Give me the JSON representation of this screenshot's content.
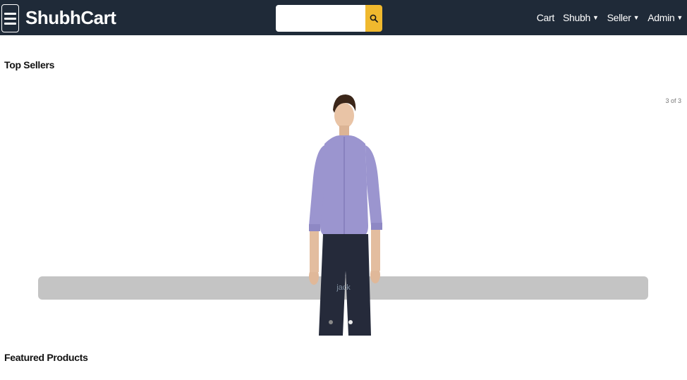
{
  "header": {
    "brand": "ShubhCart",
    "search": {
      "placeholder": "",
      "value": ""
    },
    "nav": [
      {
        "label": "Cart",
        "dropdown": false
      },
      {
        "label": "Shubh",
        "dropdown": true
      },
      {
        "label": "Seller",
        "dropdown": true
      },
      {
        "label": "Admin",
        "dropdown": true
      }
    ],
    "icons": {
      "menu": "hamburger-icon",
      "search": "search-icon",
      "dropdown": "caret-down-icon"
    }
  },
  "top_sellers": {
    "title": "Top Sellers",
    "counter": "3 of 3",
    "caption": "jack",
    "slide_count": 2,
    "active_slide_index": 1
  },
  "featured": {
    "title": "Featured Products"
  },
  "colors": {
    "header_bg": "#1f2a38",
    "search_button": "#f0b92e",
    "caption_bar": "#c4c4c4",
    "shirt": "#9b95cf",
    "pants": "#252a3a"
  }
}
